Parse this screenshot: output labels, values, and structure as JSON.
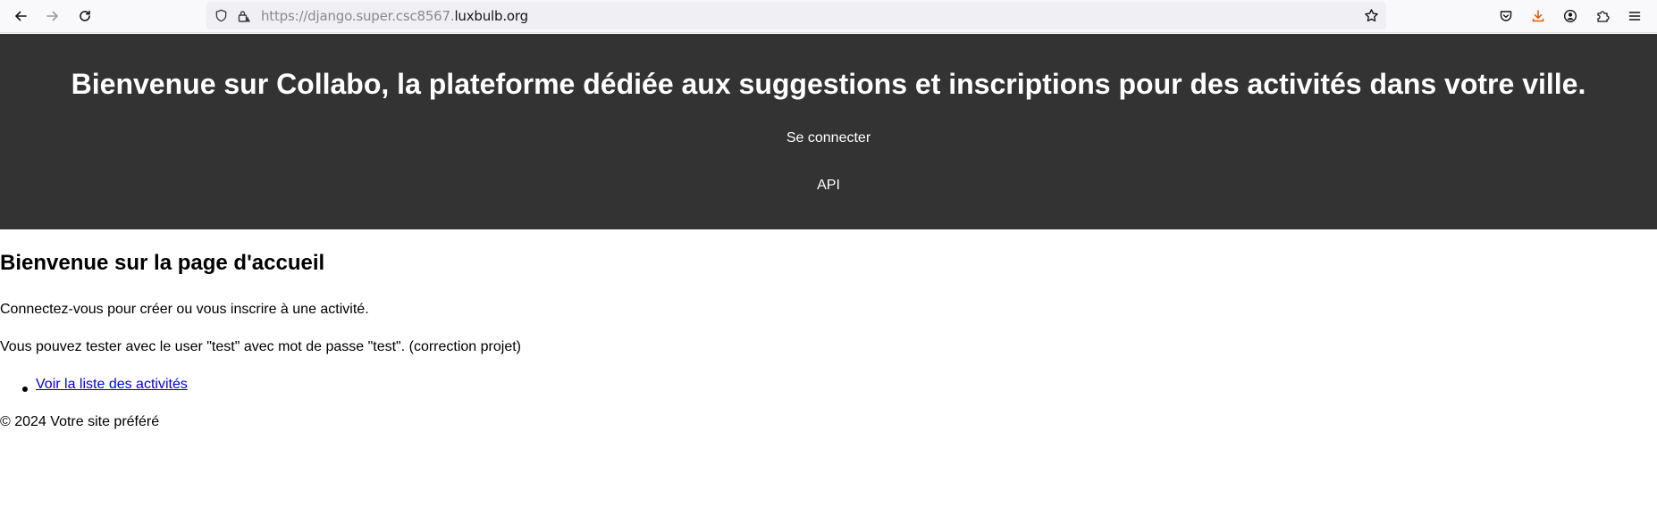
{
  "browser": {
    "url_prefix": "https://django.super.csc8567.",
    "url_domain": "luxbulb.org",
    "icons": [
      "back-arrow-icon",
      "forward-arrow-icon",
      "reload-icon",
      "shield-icon",
      "lock-warning-icon",
      "star-icon",
      "pocket-icon",
      "download-icon",
      "account-icon",
      "extensions-icon",
      "menu-icon"
    ],
    "download_icon_color": "#e8590c"
  },
  "header": {
    "title": "Bienvenue sur Collabo, la plateforme dédiée aux suggestions et inscriptions pour des activités dans votre ville.",
    "nav": {
      "login": "Se connecter",
      "api": "API"
    },
    "background_color": "#333333"
  },
  "main": {
    "heading": "Bienvenue sur la page d'accueil",
    "intro": "Connectez-vous pour créer ou vous inscrire à une activité.",
    "test_note": "Vous pouvez tester avec le user \"test\" avec mot de passe \"test\". (correction projet)",
    "links": [
      {
        "label": "Voir la liste des activités"
      }
    ]
  },
  "footer": {
    "text": "© 2024 Votre site préféré"
  }
}
